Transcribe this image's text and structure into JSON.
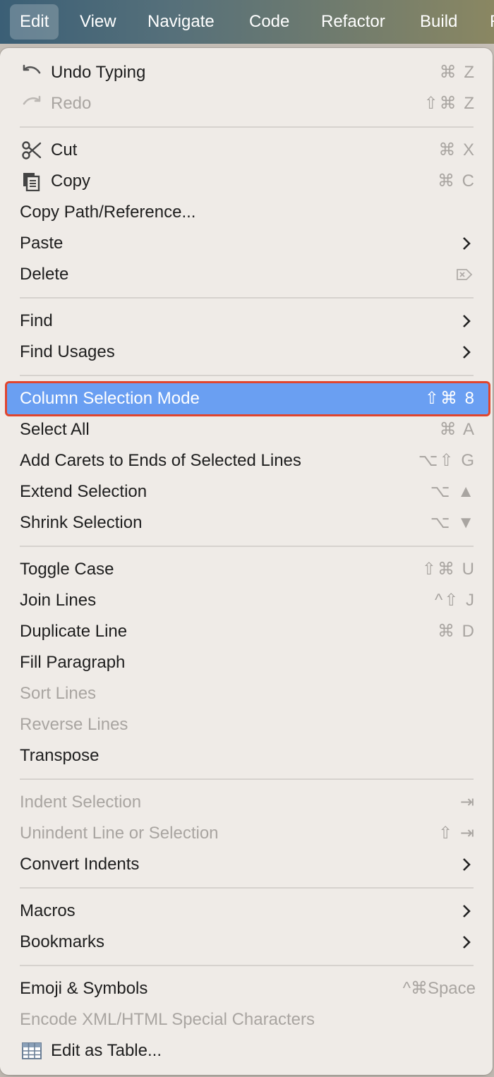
{
  "menubar": {
    "items": [
      "Edit",
      "View",
      "Navigate",
      "Code",
      "Refactor",
      "Build",
      "R"
    ]
  },
  "menu": {
    "undo": {
      "label": "Undo Typing",
      "shortcut": "⌘ Z"
    },
    "redo": {
      "label": "Redo",
      "shortcut": "⇧⌘ Z"
    },
    "cut": {
      "label": "Cut",
      "shortcut": "⌘ X"
    },
    "copy": {
      "label": "Copy",
      "shortcut": "⌘ C"
    },
    "copy_path": {
      "label": "Copy Path/Reference..."
    },
    "paste": {
      "label": "Paste"
    },
    "delete": {
      "label": "Delete"
    },
    "find": {
      "label": "Find"
    },
    "find_usages": {
      "label": "Find Usages"
    },
    "column_selection": {
      "label": "Column Selection Mode",
      "shortcut": "⇧⌘ 8"
    },
    "select_all": {
      "label": "Select All",
      "shortcut": "⌘ A"
    },
    "add_carets": {
      "label": "Add Carets to Ends of Selected Lines",
      "shortcut": "⌥⇧ G"
    },
    "extend_selection": {
      "label": "Extend Selection",
      "shortcut": "⌥ ▲"
    },
    "shrink_selection": {
      "label": "Shrink Selection",
      "shortcut": "⌥ ▼"
    },
    "toggle_case": {
      "label": "Toggle Case",
      "shortcut": "⇧⌘ U"
    },
    "join_lines": {
      "label": "Join Lines",
      "shortcut": "^⇧ J"
    },
    "duplicate_line": {
      "label": "Duplicate Line",
      "shortcut": "⌘ D"
    },
    "fill_paragraph": {
      "label": "Fill Paragraph"
    },
    "sort_lines": {
      "label": "Sort Lines"
    },
    "reverse_lines": {
      "label": "Reverse Lines"
    },
    "transpose": {
      "label": "Transpose"
    },
    "indent_selection": {
      "label": "Indent Selection",
      "shortcut": "⇥"
    },
    "unindent": {
      "label": "Unindent Line or Selection",
      "shortcut": "⇧ ⇥"
    },
    "convert_indents": {
      "label": "Convert Indents"
    },
    "macros": {
      "label": "Macros"
    },
    "bookmarks": {
      "label": "Bookmarks"
    },
    "emoji": {
      "label": "Emoji & Symbols",
      "shortcut": "^⌘Space"
    },
    "encode_xml": {
      "label": "Encode XML/HTML Special Characters"
    },
    "edit_table": {
      "label": "Edit as Table..."
    }
  },
  "colors": {
    "highlight": "#6a9ff2",
    "highlight_outline": "#e0452e",
    "menu_bg": "#efebe7",
    "disabled_text": "#a9a5a1"
  }
}
